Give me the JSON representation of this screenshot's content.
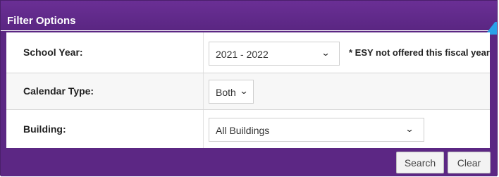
{
  "header": {
    "title": "Filter Options"
  },
  "filters": {
    "school_year": {
      "label": "School Year:",
      "value": "2021 - 2022",
      "note": "* ESY not offered this fiscal year"
    },
    "calendar_type": {
      "label": "Calendar Type:",
      "value": "Both"
    },
    "building": {
      "label": "Building:",
      "value": "All Buildings"
    }
  },
  "icons": {
    "dropdown": "⌄"
  },
  "buttons": {
    "search": "Search",
    "clear": "Clear"
  },
  "colors": {
    "header": "#5b2783",
    "accent": "#2aa1e8"
  }
}
